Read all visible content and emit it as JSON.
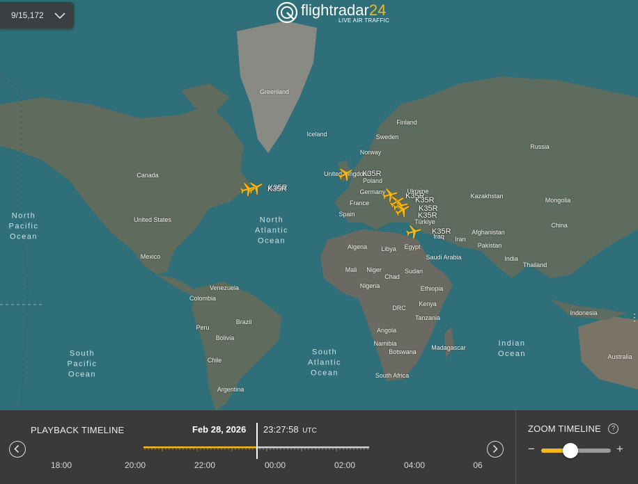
{
  "selector": {
    "label": "9/15,172"
  },
  "logo": {
    "brand_main": "flightradar",
    "brand_num": "24",
    "tagline": "LIVE AIR TRAFFIC"
  },
  "map": {
    "country_labels": [
      "Greenland",
      "Iceland",
      "Finland",
      "Sweden",
      "Norway",
      "Russia",
      "United Kingdom",
      "Poland",
      "Germany",
      "France",
      "Ukraine",
      "Kazakhstan",
      "Mongolia",
      "Spain",
      "Türkiye",
      "China",
      "Afghanistan",
      "Iraq",
      "Iran",
      "Pakistan",
      "India",
      "Thailand",
      "Canada",
      "United States",
      "Mexico",
      "Algeria",
      "Libya",
      "Egypt",
      "Saudi Arabia",
      "Mali",
      "Niger",
      "Chad",
      "Sudan",
      "Nigeria",
      "Ethiopia",
      "DRC",
      "Kenya",
      "Tanzania",
      "Angola",
      "Namibia",
      "Botswana",
      "South Africa",
      "Madagascar",
      "Venezuela",
      "Colombia",
      "Brazil",
      "Peru",
      "Bolivia",
      "Chile",
      "Argentina",
      "Indonesia",
      "Australia"
    ],
    "ocean_labels": [
      "North\nPacific\nOcean",
      "North\nAtlantic\nOcean",
      "South\nPacific\nOcean",
      "South\nAtlantic\nOcean",
      "Indian\nOcean"
    ],
    "aircraft": [
      {
        "callsign": "K35R"
      },
      {
        "callsign": "K35R"
      },
      {
        "callsign": "K35R"
      },
      {
        "callsign": "K35R"
      },
      {
        "callsign": "K35R"
      },
      {
        "callsign": "K35R"
      },
      {
        "callsign": "K35R"
      },
      {
        "callsign": "K35R"
      }
    ]
  },
  "timeline": {
    "title": "PLAYBACK TIMELINE",
    "date": "Feb 28, 2026",
    "time": "23:27:58",
    "timezone": "UTC",
    "hour_labels": [
      "18:00",
      "20:00",
      "22:00",
      "00:00",
      "02:00",
      "04:00",
      "06"
    ],
    "progress": 0.5
  },
  "zoom": {
    "title": "ZOOM TIMELINE",
    "help": "?",
    "minus": "−",
    "plus": "+",
    "level": 0.42
  },
  "colors": {
    "accent": "#f5b81c",
    "ocean": "#2f6f79",
    "land": "#5e6b5f",
    "panel": "#3a3a3a"
  }
}
